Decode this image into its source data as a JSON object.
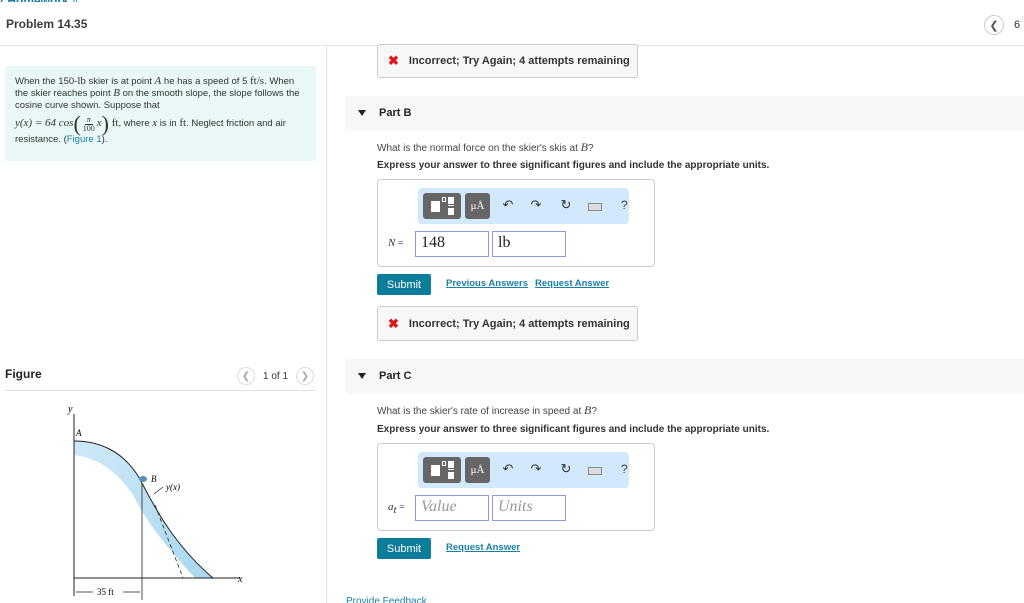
{
  "header": {
    "breadcrumb_partial": "‹ Homework #...",
    "title": "Problem 14.35",
    "page_number": "6"
  },
  "problem": {
    "text_1": "When the 150-",
    "unit_lb": "lb",
    "text_2": " skier is at point ",
    "point_a": "A",
    "text_3": " he has a speed of 5 ",
    "speed_unit": "ft/s",
    "text_4": ". When the skier reaches point ",
    "point_b": "B",
    "text_5": " on the smooth slope, the slope follows the cosine curve shown. Suppose that",
    "eq_lhs": "y(x) = 64 cos",
    "eq_num": "π",
    "eq_den": "100",
    "eq_var": "x",
    "eq_unit": "ft",
    "text_6": ", where ",
    "var_x": "x",
    "text_7": " is in ",
    "unit_ft": "ft",
    "text_8": ". Neglect friction and air resistance. (",
    "figure_link": "Figure 1",
    "text_9": ")."
  },
  "figure": {
    "label": "Figure",
    "counter": "1 of 1",
    "labels": {
      "y_axis": "y",
      "x_axis": "x",
      "point_a": "A",
      "point_b": "B",
      "curve": "y(x)",
      "dimension": "35 ft"
    }
  },
  "part_a_feedback": {
    "message": "Incorrect; Try Again; 4 attempts remaining"
  },
  "part_b": {
    "label": "Part B",
    "question_prefix": "What is the normal force on the skier's skis at ",
    "question_var": "B",
    "question_suffix": "?",
    "instruction": "Express your answer to three significant figures and include the appropriate units.",
    "var_label": "N",
    "var_eq": " =",
    "value": "148",
    "units": "lb",
    "submit": "Submit",
    "previous_answers": "Previous Answers",
    "request_answer": "Request Answer",
    "feedback": "Incorrect; Try Again; 4 attempts remaining"
  },
  "part_c": {
    "label": "Part C",
    "question_prefix": "What is the skier's rate of increase in speed at ",
    "question_var": "B",
    "question_suffix": "?",
    "instruction": "Express your answer to three significant figures and include the appropriate units.",
    "var_label": "a",
    "var_sub": "t",
    "var_eq": " =",
    "value_placeholder": "Value",
    "units_placeholder": "Units",
    "submit": "Submit",
    "request_answer": "Request Answer"
  },
  "toolbar": {
    "units_label": "μÅ",
    "undo": "↶",
    "redo": "↷",
    "reset": "↻",
    "help": "?"
  },
  "footer": {
    "feedback_link": "Provide Feedback"
  }
}
